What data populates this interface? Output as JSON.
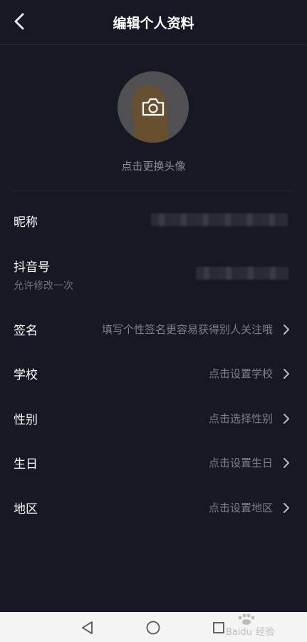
{
  "header": {
    "title": "编辑个人资料"
  },
  "avatar": {
    "caption": "点击更换头像"
  },
  "fields": {
    "nickname": {
      "label": "昵称"
    },
    "douyin_id": {
      "label": "抖音号",
      "note": "允许修改一次"
    },
    "signature": {
      "label": "签名",
      "placeholder": "填写个性签名更容易获得别人关注哦"
    },
    "school": {
      "label": "学校",
      "placeholder": "点击设置学校"
    },
    "gender": {
      "label": "性别",
      "placeholder": "点击选择性别"
    },
    "birthday": {
      "label": "生日",
      "placeholder": "点击设置生日"
    },
    "region": {
      "label": "地区",
      "placeholder": "点击设置地区"
    }
  },
  "nav": {
    "icons": [
      "back-triangle-icon",
      "home-circle-icon",
      "recents-square-icon"
    ]
  },
  "watermark": {
    "text": "Baidu经验"
  },
  "colors": {
    "background": "#161823",
    "text": "#ffffff",
    "secondary": "#7d808a"
  }
}
